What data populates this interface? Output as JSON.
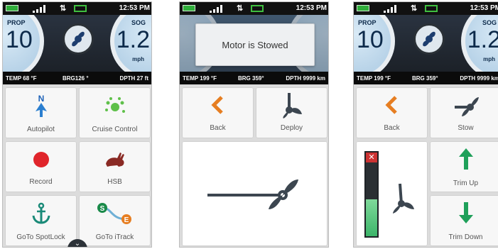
{
  "screens": [
    {
      "status": {
        "time": "12:53 PM"
      },
      "gauges": {
        "prop_label": "PROP",
        "prop_value": "10",
        "sog_label": "SOG",
        "sog_value": "1.2",
        "sog_unit": "mph"
      },
      "info": {
        "temp": "TEMP 68 °F",
        "brg": "BRG126 °",
        "depth": "DPTH 27 ft"
      },
      "tiles": {
        "autopilot": "Autopilot",
        "cruise": "Cruise Control",
        "record": "Record",
        "hsb": "HSB",
        "spotlock": "GoTo SpotLock",
        "itrack": "GoTo iTrack"
      }
    },
    {
      "status": {
        "time": "12:53 PM"
      },
      "info": {
        "temp": "TEMP 199 °F",
        "brg": "BRG 359°",
        "depth": "DPTH 9999 km"
      },
      "dialog": "Motor is Stowed",
      "tiles": {
        "back": "Back",
        "deploy": "Deploy"
      }
    },
    {
      "status": {
        "time": "12:53 PM"
      },
      "gauges": {
        "prop_label": "PROP",
        "prop_value": "10",
        "sog_label": "SOG",
        "sog_value": "1.2",
        "sog_unit": "mph"
      },
      "info": {
        "temp": "TEMP 199 °F",
        "brg": "BRG 359°",
        "depth": "DPTH 9999 km"
      },
      "tiles": {
        "back": "Back",
        "stow": "Stow",
        "trim_up": "Trim Up",
        "trim_down": "Trim Down"
      }
    }
  ],
  "colors": {
    "blue": "#2b7fd0",
    "orange": "#e67e22",
    "green": "#1fa05a",
    "red": "#e0252b",
    "dark": "#3c4650"
  }
}
